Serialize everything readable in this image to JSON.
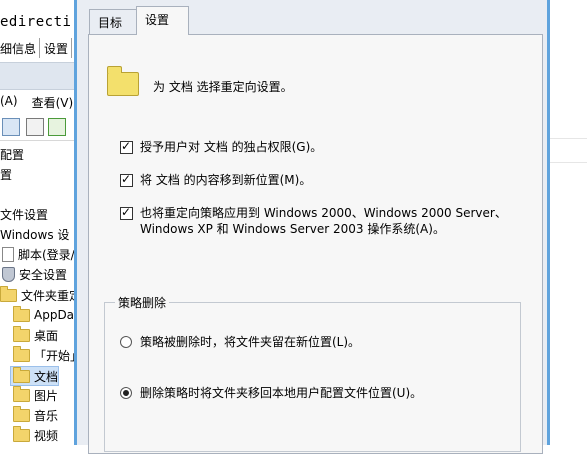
{
  "background_window": {
    "title": "edirecti",
    "tabs": [
      "细信息",
      "设置"
    ],
    "menu": [
      "(A)",
      "查看(V)"
    ],
    "tree": [
      {
        "label": "配置",
        "icon": "none"
      },
      {
        "label": "置",
        "icon": "none"
      },
      {
        "label": "文件设置",
        "icon": "none"
      },
      {
        "label": "Windows 设",
        "icon": "none"
      },
      {
        "label": "脚本(登录/",
        "icon": "script-icon"
      },
      {
        "label": "安全设置",
        "icon": "shield-icon"
      },
      {
        "label": "文件夹重定",
        "icon": "folder-icon"
      },
      {
        "label": "AppDa",
        "icon": "folder-icon"
      },
      {
        "label": "桌面",
        "icon": "folder-icon"
      },
      {
        "label": "「开始」",
        "icon": "folder-icon"
      },
      {
        "label": "文档",
        "icon": "folder-icon",
        "selected": true
      },
      {
        "label": "图片",
        "icon": "folder-icon"
      },
      {
        "label": "音乐",
        "icon": "folder-icon"
      },
      {
        "label": "视频",
        "icon": "folder-icon"
      }
    ]
  },
  "dialog": {
    "tabs": {
      "target": "目标",
      "settings": "设置"
    },
    "heading": "为 文档 选择重定向设置。",
    "checkboxes": {
      "exclusive": "授予用户对 文档 的独占权限(G)。",
      "move": "将 文档 的内容移到新位置(M)。",
      "apply_line1": "也将重定向策略应用到 Windows 2000、Windows 2000 Server、",
      "apply_line2": "Windows XP 和 Windows Server 2003 操作系统(A)。"
    },
    "policy_removal": {
      "title": "策略删除",
      "option_leave": "策略被删除时，将文件夹留在新位置(L)。",
      "option_redirect_back": "删除策略时将文件夹移回本地用户配置文件位置(U)。"
    }
  }
}
